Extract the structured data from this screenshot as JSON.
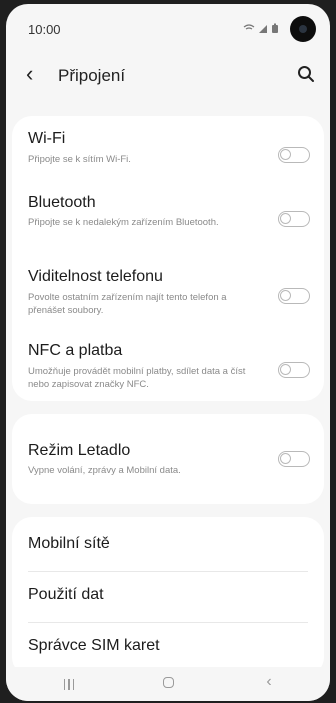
{
  "status_bar": {
    "time": "10:00",
    "icons": "≈ .❙▮"
  },
  "header": {
    "title": "Připojení"
  },
  "card_connections": [
    {
      "label": "Wi-Fi",
      "desc": "Připojte se k sítím Wi-Fi.",
      "toggle_on": false
    },
    {
      "label": "Bluetooth",
      "desc": "Připojte se k nedalekým zařízením Bluetooth.",
      "toggle_on": false
    },
    {
      "label": "Viditelnost telefonu",
      "desc": "Povolte ostatním zařízením najít tento telefon a přenášet soubory.",
      "toggle_on": false
    },
    {
      "label": "NFC a platba",
      "desc": "Umožňuje provádět mobilní platby, sdílet data a číst nebo zapisovat značky NFC.",
      "toggle_on": false
    }
  ],
  "card_airplane": {
    "label": "Režim Letadlo",
    "desc": "Vypne volání, zprávy a Mobilní data.",
    "toggle_on": false
  },
  "card_menu": [
    {
      "label": "Mobilní sítě"
    },
    {
      "label": "Použití dat"
    },
    {
      "label": "Správce SIM karet"
    }
  ],
  "nav_bar": {
    "recents": "recents-icon",
    "home": "home-icon",
    "back": "back-icon"
  }
}
